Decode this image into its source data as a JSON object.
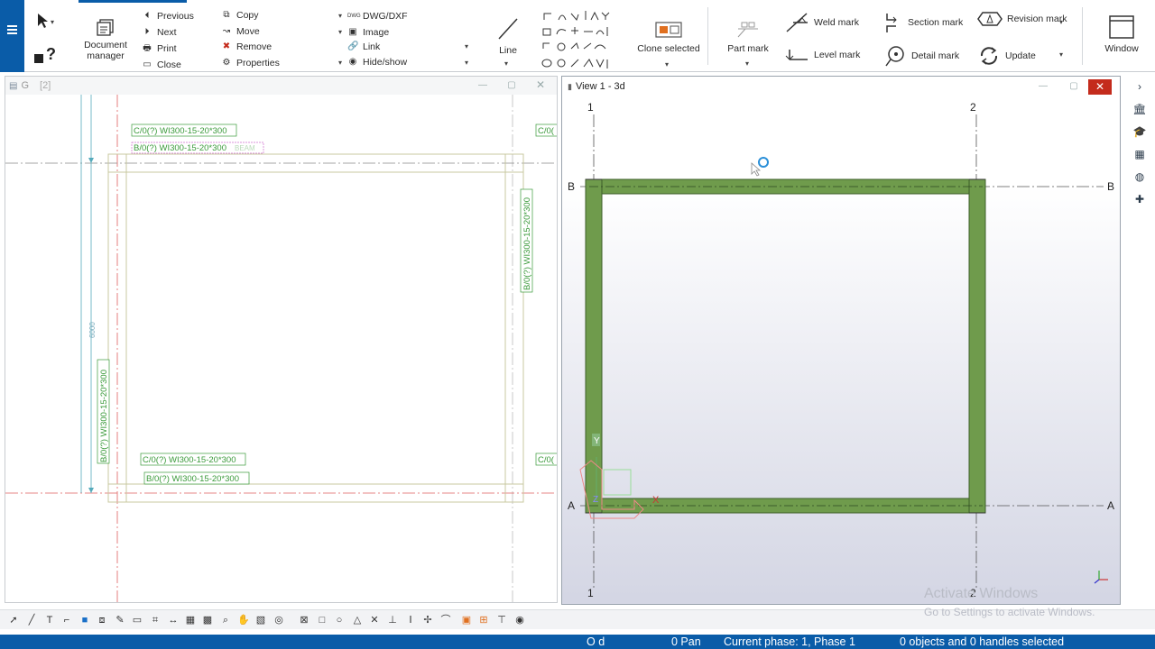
{
  "ribbon": {
    "document_manager": "Document manager",
    "previous": "Previous",
    "next": "Next",
    "print": "Print",
    "close": "Close",
    "copy": "Copy",
    "move": "Move",
    "remove": "Remove",
    "properties": "Properties",
    "dwg_dxf": "DWG/DXF",
    "image": "Image",
    "link": "Link",
    "hide_show": "Hide/show",
    "line": "Line",
    "clone_selected": "Clone selected",
    "part_mark": "Part mark",
    "weld_mark": "Weld mark",
    "level_mark": "Level mark",
    "section_mark": "Section mark",
    "detail_mark": "Detail mark",
    "revision_mark": "Revision mark",
    "update": "Update",
    "window": "Window"
  },
  "left_view": {
    "title": "G",
    "subtitle": "[2]",
    "labels": {
      "col_top_left": "C/0(?) WI300-15-20*300",
      "beam_top": "B/0(?) WI300-15-20*300",
      "beam_top_tag": "BEAM",
      "col_top_right": "C/0(",
      "beam_right_vertical": "B/0(?) WI300-15-20*300",
      "dimension": "6000",
      "beam_left_vertical": "B/0(?) WI300-15-20*300",
      "col_bottom_left": "C/0(?) WI300-15-20*300",
      "beam_bottom": "B/0(?) WI300-15-20*300",
      "col_bottom_right": "C/0("
    }
  },
  "right_view": {
    "title": "View 1 - 3d",
    "grid": {
      "top_1": "1",
      "top_2": "2",
      "left_B": "B",
      "right_B": "B",
      "left_A": "A",
      "right_A": "A",
      "bottom_1": "1",
      "bottom_2": "2"
    },
    "axes": {
      "y": "Y",
      "z": "Z",
      "x": "X"
    },
    "member_color": "#6f9b4c"
  },
  "status": {
    "od": "O d",
    "pan": "0  Pan",
    "phase": "Current phase: 1, Phase 1",
    "selection": "0 objects and 0 handles selected"
  },
  "watermark": {
    "line1": "Activate Windows",
    "line2": "Go to Settings to activate Windows."
  },
  "colors": {
    "brand_blue": "#0a5ca8",
    "close_red": "#c42b1c",
    "drawing_green": "#3a9a3a"
  }
}
